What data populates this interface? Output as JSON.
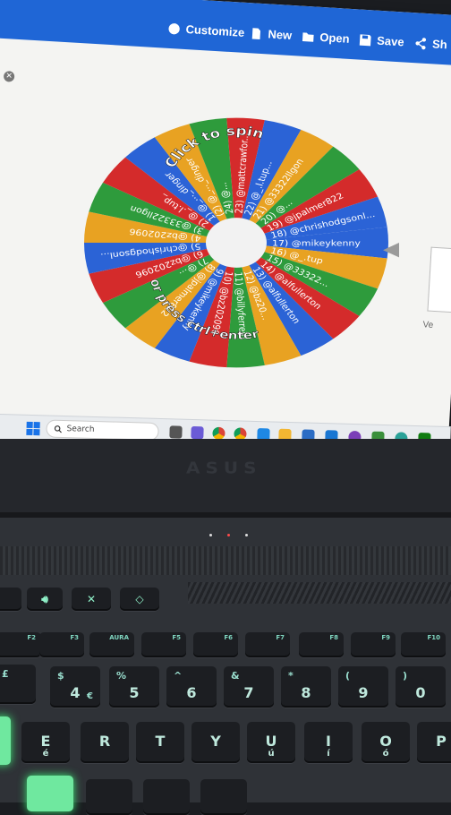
{
  "toolbar": {
    "customize": "Customize",
    "new": "New",
    "open": "Open",
    "save": "Save",
    "share": "Sh"
  },
  "wheel": {
    "center_text_top": "Click to spin",
    "center_text_bottom": "or press ctrl+enter",
    "entries": [
      "17) @mikeykenny",
      "16) @_.tup",
      "15) @33322...",
      "14) @alfullerton",
      "13) @alfullerton",
      "12) @bz20...",
      "11) @billyferreiu",
      "10) @bz202096",
      "9) @mikeykenny",
      "8) @jpalmer822",
      "7) @...",
      "6) @bz202096",
      "5) @chrishodgsonl...",
      "4) @bz202096",
      "3) @33322llgon",
      "2) @_.l.tup_",
      "1) @_..._dinger",
      "(2) @_..._dinger",
      "24) @...",
      "23) @mattcrawfor...",
      "22) @_.l.tup...",
      "21) @33322llgon",
      "20) @...",
      "19) @jpalmer822",
      "18) @chrishodgsonl..."
    ],
    "colors": [
      "#2b63d6",
      "#e8a222",
      "#2e9b3c",
      "#d42b2b"
    ]
  },
  "side": {
    "label": "Ve"
  },
  "taskbar": {
    "search_placeholder": "Search"
  },
  "laptop": {
    "brand": "ASUS"
  },
  "keyboard": {
    "fn_row": [
      "F2",
      "F3",
      "AURA",
      "F5",
      "F6",
      "F7",
      "F8",
      "F9",
      "F10"
    ],
    "num_row": [
      {
        "main": "4",
        "sub": "$",
        "alt": "€"
      },
      {
        "main": "5",
        "sub": "%"
      },
      {
        "main": "6",
        "sub": "^"
      },
      {
        "main": "7",
        "sub": "&"
      },
      {
        "main": "8",
        "sub": "*"
      },
      {
        "main": "9",
        "sub": "("
      },
      {
        "main": "0",
        "sub": ")"
      }
    ],
    "num_row_left": {
      "main": "£",
      "sub": ""
    },
    "letter_row": [
      {
        "main": "E",
        "alt": "é"
      },
      {
        "main": "R"
      },
      {
        "main": "T"
      },
      {
        "main": "Y"
      },
      {
        "main": "U",
        "alt": "ú"
      },
      {
        "main": "I",
        "alt": "í"
      },
      {
        "main": "O",
        "alt": "ó"
      },
      {
        "main": "P"
      }
    ]
  }
}
